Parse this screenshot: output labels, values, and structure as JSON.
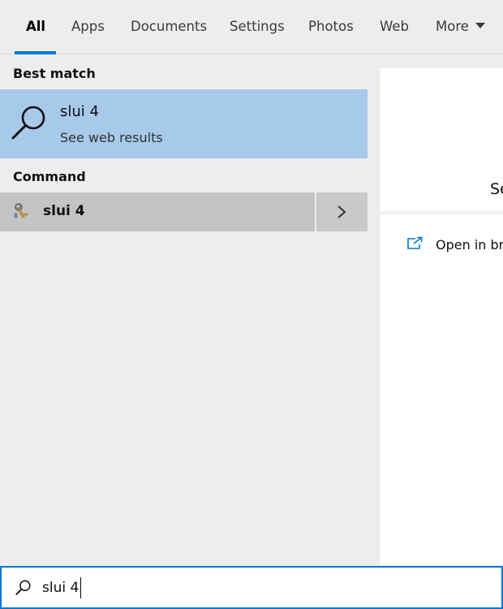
{
  "tabs": {
    "items": [
      {
        "label": "All",
        "active": true
      },
      {
        "label": "Apps"
      },
      {
        "label": "Documents"
      },
      {
        "label": "Settings"
      },
      {
        "label": "Photos"
      },
      {
        "label": "Web"
      },
      {
        "label": "More"
      }
    ]
  },
  "best_match": {
    "header": "Best match",
    "title": "slui 4",
    "subtitle": "See web results",
    "icon": "search-icon"
  },
  "command": {
    "header": "Command",
    "label": "slui 4",
    "icon": "key-icon"
  },
  "preview": {
    "title": "Se",
    "open_label": "Open in bro"
  },
  "search": {
    "value": "slui 4"
  },
  "colors": {
    "accent": "#0078d7",
    "selected_bg": "#a7c9ea",
    "command_bg": "#c4c4c4"
  }
}
